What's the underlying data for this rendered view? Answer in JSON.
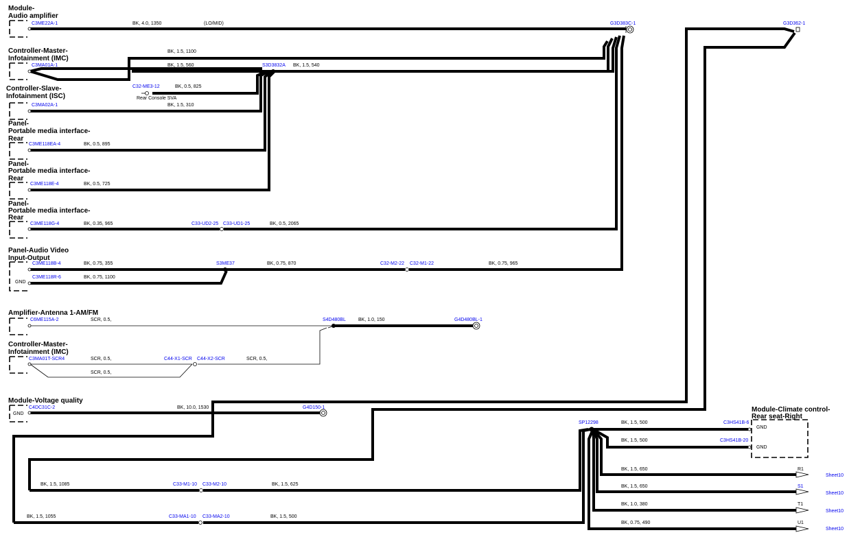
{
  "modules": {
    "audio_amp": [
      "Module-",
      "Audio amplifier"
    ],
    "imc": [
      "Controller-Master-",
      "Infotainment (IMC)"
    ],
    "isc": [
      "Controller-Slave-",
      "Infotainment (ISC)"
    ],
    "pmi1": [
      "Panel-",
      "Portable media interface-",
      "Rear"
    ],
    "pmi2": [
      "Panel-",
      "Portable media interface-",
      "Rear"
    ],
    "pmi3": [
      "Panel-",
      "Portable media interface-",
      "Rear"
    ],
    "avio": [
      "Panel-Audio Video",
      "Input-Output"
    ],
    "antenna": [
      "Amplifier-Antenna 1-AM/FM"
    ],
    "imc2": [
      "Controller-Master-",
      "Infotainment (IMC)"
    ],
    "voltage": [
      "Module-Voltage quality"
    ],
    "climate": [
      "Module-Climate control-",
      "Rear seat-Right"
    ]
  },
  "connectors": {
    "c3me22a": "C3ME22A-1",
    "c3ma01a": "C3MA01A-1",
    "c3ma02a": "C3MA02A-1",
    "c32me3": "C32-ME3-12",
    "s3d3832a": "S3D3832A",
    "g3d383c": "G3D383C-1",
    "g3d362": "G3D362-1",
    "c3me118ea": "C3ME118EA-4",
    "c3me118e": "C3ME118E-4",
    "c3me118g": "C3ME118G-4",
    "c33ud2": "C33-UD2-25",
    "c33ud1": "C33-UD1-25",
    "c3me118b": "C3ME118B-4",
    "c3me118r": "C3ME118R-6",
    "s3me37": "S3ME37",
    "c32m2": "C32-M2-22",
    "c32m1": "C32-M1-22",
    "c6me115a": "C6ME115A-2",
    "s4d480bl": "S4D480BL",
    "g4d480bl": "G4D480BL-1",
    "c3ma01t": "C3MA01T-SCR4",
    "c44x1": "C44-X1-SCR",
    "c44x2": "C44-X2-SCR",
    "c4dc31c": "C4DC31C-2",
    "g4d150": "G4D150-1",
    "sp12298": "SP12298",
    "c3hs41b6": "C3HS41B-6",
    "c3hs41b20": "C3HS41B-20",
    "c33m110": "C33-M1-10",
    "c33m210": "C33-M2-10",
    "c33ma110": "C33-MA1-10",
    "c33ma210": "C33-MA2-10"
  },
  "wires": {
    "w_amp": "BK, 4.0, 1350",
    "w_amp_note": "(LO/MID)",
    "w_imc_top": "BK, 1.5, 1100",
    "w_imc_mid": "BK, 1.5, 560",
    "w_splice_out": "BK, 1.5, 540",
    "w_me3": "BK, 0.5, 825",
    "w_isc": "BK, 1.5, 310",
    "w_pmi1": "BK, 0.5, 895",
    "w_pmi2": "BK, 0.5, 725",
    "w_pmi3a": "BK, 0.35, 965",
    "w_pmi3b": "BK, 0.5, 2065",
    "w_avio1": "BK, 0.75, 355",
    "w_avio2": "BK, 0.75, 1100",
    "w_s3me37": "BK, 0.75, 870",
    "w_m1_22": "BK, 0.75, 965",
    "w_ant": "SCR, 0.5,",
    "w_s4d": "BK, 1.0, 150",
    "w_imc2a": "SCR, 0.5,",
    "w_imc2b": "SCR, 0.5,",
    "w_imc2c": "SCR, 0.5,",
    "w_volt": "BK, 10.0, 1530",
    "w_cl1": "BK, 1.5, 500",
    "w_cl2": "BK, 1.5, 500",
    "w_r1": "BK, 1.5, 650",
    "w_s1": "BK, 1.5, 650",
    "w_t1": "BK, 1.0, 380",
    "w_u1": "BK, 0.75, 490",
    "w_m1_10a": "BK, 1.5, 1085",
    "w_m1_10b": "BK, 1.5, 625",
    "w_ma1a": "BK, 1.5, 1055",
    "w_ma1b": "BK, 1.5, 500"
  },
  "labels": {
    "rear_console": "Rear Console SVA",
    "gnd": "GND",
    "r1": "R1",
    "s1": "S1",
    "t1": "T1",
    "u1": "U1",
    "sheet": "Sheet10"
  },
  "colors": {
    "wire": "#000000",
    "connector": "#0000ee",
    "background": "#ffffff"
  }
}
